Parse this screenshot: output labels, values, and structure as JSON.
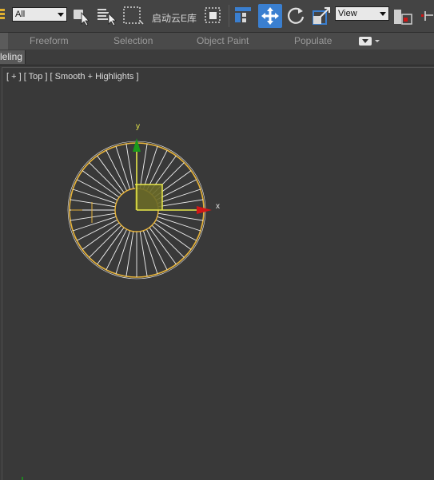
{
  "toolbar": {
    "selection_filter": "All",
    "cloud_library_label": "启动云E库",
    "reference_coord": "View"
  },
  "ribbon": {
    "tabs": [
      "Freeform",
      "Selection",
      "Object Paint",
      "Populate"
    ]
  },
  "modeling": {
    "label": "leling"
  },
  "viewport": {
    "label": "[ + ] [ Top ] [ Smooth + Highlights ]",
    "axis_x": "x",
    "axis_y": "y"
  },
  "colors": {
    "selection_wire": "#e8b43a",
    "axis_x": "#d01616",
    "axis_y": "#1a9a1a",
    "plane_handle": "#e8e84a",
    "active_tool": "#3a7fd0"
  },
  "icons": [
    "teapot-icon",
    "select-object-icon",
    "select-by-name-icon",
    "rectangular-selection-icon",
    "window-crossing-icon",
    "layer-icon",
    "select-and-move-icon",
    "select-and-rotate-icon",
    "select-and-scale-icon",
    "pivot-icon",
    "snap-icon"
  ]
}
